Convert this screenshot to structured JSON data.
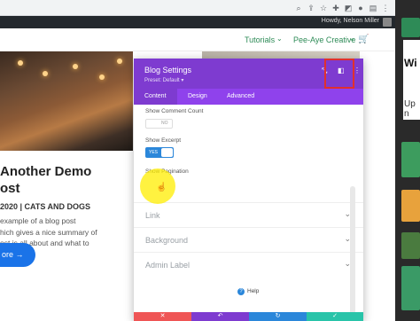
{
  "admin_bar": {
    "howdy": "Howdy, Nelson Miller"
  },
  "nav": {
    "items": [
      {
        "label": "Tutorials",
        "chevron": "⌄"
      },
      {
        "label": "Pee-Aye Creative",
        "chevron": "⌄"
      }
    ],
    "cart_icon": "cart-icon"
  },
  "post": {
    "title": "Another Demo Post",
    "title_visible": "Another Demo\nost",
    "meta": "2020 | CATS AND DOGS",
    "excerpt": "example of a blog post\nhich gives a nice summary of\nost is all about and what to",
    "read_more": "ore →"
  },
  "modal": {
    "title": "Blog Settings",
    "preset": "Preset: Default ▾",
    "tabs": [
      "Content",
      "Design",
      "Advanced"
    ],
    "options": [
      {
        "label": "Show Comment Count",
        "state": "NO"
      },
      {
        "label": "Show Excerpt",
        "state": "YES"
      },
      {
        "label": "Show Pagination"
      }
    ],
    "sections": [
      "Link",
      "Background",
      "Admin Label"
    ],
    "help": "Help",
    "footer_buttons": [
      {
        "label": "✕",
        "color": "#ef5555"
      },
      {
        "label": "↶",
        "color": "#7e3bd0"
      },
      {
        "label": "↻",
        "color": "#2b87da"
      },
      {
        "label": "✓",
        "color": "#29c4a9"
      }
    ]
  },
  "right_strip": {
    "labels": [
      "Wi",
      "Up n"
    ]
  },
  "colors": {
    "accent_purple": "#7e3bd0",
    "tab_purple": "#8f42ec",
    "toggle_blue": "#2b87da",
    "nav_green": "#2e8b57",
    "highlight_red": "#e0302e"
  }
}
